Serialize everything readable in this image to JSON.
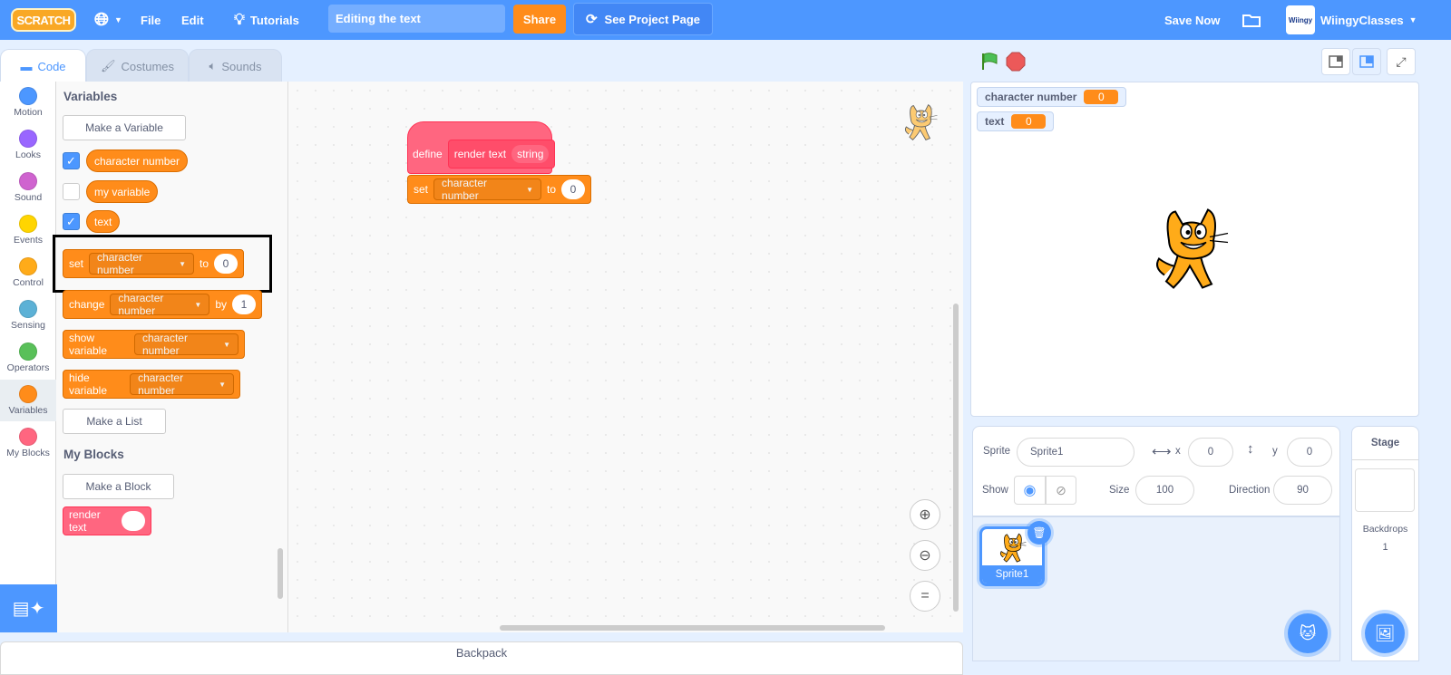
{
  "topbar": {
    "logo": "SCRATCH",
    "file": "File",
    "edit": "Edit",
    "tutorials": "Tutorials",
    "project_title": "Editing the text",
    "share": "Share",
    "see_project_page": "See Project Page",
    "save_now": "Save Now",
    "username": "WiingyClasses",
    "avatar_text": "Wiingy"
  },
  "tabs": [
    {
      "label": "Code"
    },
    {
      "label": "Costumes"
    },
    {
      "label": "Sounds"
    }
  ],
  "categories": [
    {
      "label": "Motion",
      "color": "#4c97ff"
    },
    {
      "label": "Looks",
      "color": "#9966ff"
    },
    {
      "label": "Sound",
      "color": "#cf63cf"
    },
    {
      "label": "Events",
      "color": "#ffd500"
    },
    {
      "label": "Control",
      "color": "#ffab19"
    },
    {
      "label": "Sensing",
      "color": "#5cb1d6"
    },
    {
      "label": "Operators",
      "color": "#59c059"
    },
    {
      "label": "Variables",
      "color": "#ff8c1a"
    },
    {
      "label": "My Blocks",
      "color": "#ff6680"
    }
  ],
  "palette": {
    "variables_heading": "Variables",
    "make_variable": "Make a Variable",
    "vars": [
      {
        "name": "character number",
        "checked": true
      },
      {
        "name": "my variable",
        "checked": false
      },
      {
        "name": "text",
        "checked": true
      }
    ],
    "set_block": {
      "set": "set",
      "var": "character number",
      "to": "to",
      "value": "0"
    },
    "change_block": {
      "change": "change",
      "var": "character number",
      "by": "by",
      "value": "1"
    },
    "show_block": {
      "label": "show variable",
      "var": "character number"
    },
    "hide_block": {
      "label": "hide variable",
      "var": "character number"
    },
    "make_list": "Make a List",
    "myblocks_heading": "My Blocks",
    "make_block": "Make a Block",
    "render_block": "render text"
  },
  "script": {
    "define": "define",
    "proc": "render text",
    "param": "string",
    "set": "set",
    "var": "character number",
    "to": "to",
    "value": "0"
  },
  "backpack": "Backpack",
  "monitors": [
    {
      "name": "character number",
      "value": "0"
    },
    {
      "name": "text",
      "value": "0"
    }
  ],
  "sprite_info": {
    "sprite_label": "Sprite",
    "sprite_name": "Sprite1",
    "x_label": "x",
    "x": "0",
    "y_label": "y",
    "y": "0",
    "show_label": "Show",
    "size_label": "Size",
    "size": "100",
    "direction_label": "Direction",
    "direction": "90"
  },
  "sprites": [
    {
      "name": "Sprite1",
      "selected": true
    }
  ],
  "stage_panel": {
    "title": "Stage",
    "backdrops_label": "Backdrops",
    "backdrops_count": "1"
  }
}
